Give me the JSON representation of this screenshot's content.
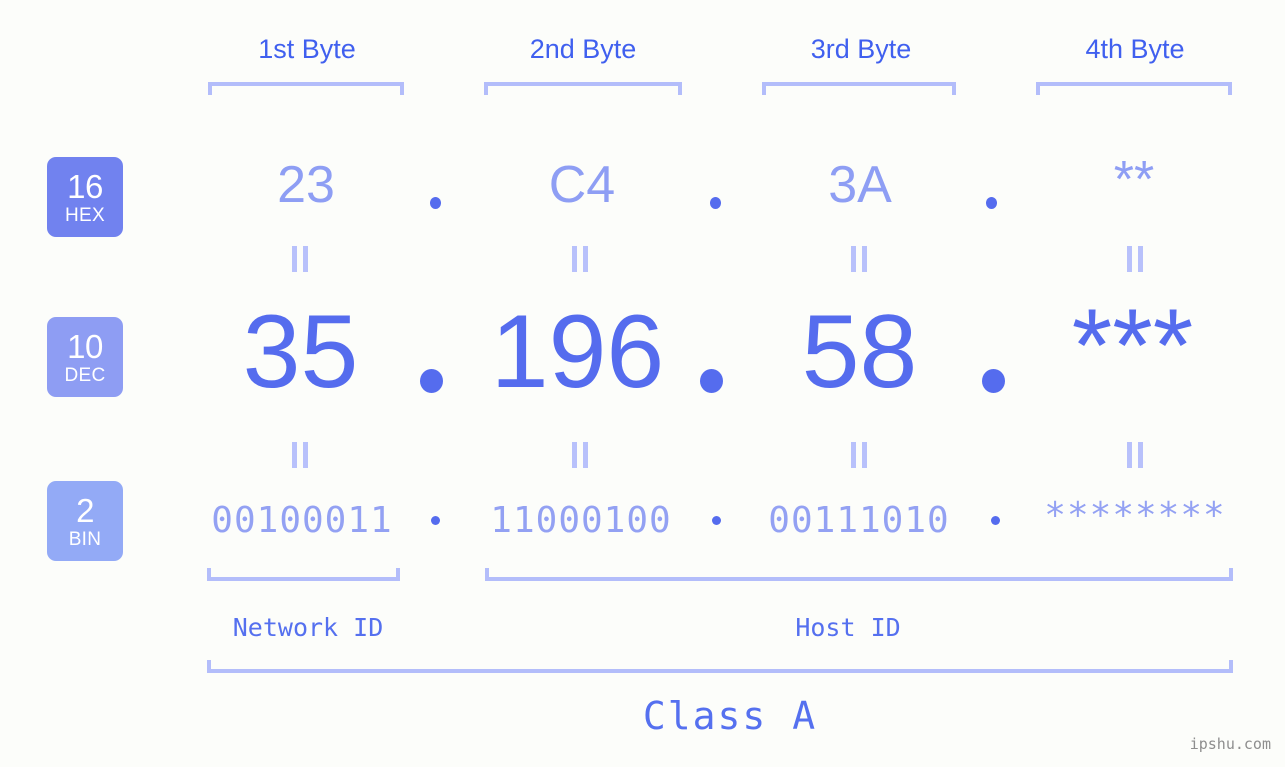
{
  "watermark": "ipshu.com",
  "colors": {
    "background": "#fcfdfa",
    "header_text": "#4060ef",
    "bracket": "#b3bdfa",
    "hex_value": "#8e9ef4",
    "dec_value": "#556cee",
    "bin_value": "#93a1f3",
    "dot": "#556cee",
    "equals": "#b8c1fb",
    "caption": "#5570ef",
    "badge_hex_bg": "#7182ef",
    "badge_dec_bg": "#8e9df3",
    "badge_bin_bg": "#93aaf6",
    "watermark": "#8e8e8e"
  },
  "byte_headers": [
    {
      "label": "1st Byte"
    },
    {
      "label": "2nd Byte"
    },
    {
      "label": "3rd Byte"
    },
    {
      "label": "4th Byte"
    }
  ],
  "radix_badges": [
    {
      "number": "16",
      "name": "HEX"
    },
    {
      "number": "10",
      "name": "DEC"
    },
    {
      "number": "2",
      "name": "BIN"
    }
  ],
  "rows": {
    "hex": {
      "values": [
        "23",
        "C4",
        "3A",
        "**"
      ]
    },
    "dec": {
      "values": [
        "35",
        "196",
        "58",
        "***"
      ]
    },
    "bin": {
      "values": [
        "00100011",
        "11000100",
        "00111010",
        "********"
      ]
    }
  },
  "separators": {
    "hex": [
      ".",
      ".",
      "."
    ],
    "dec": [
      ".",
      ".",
      "."
    ],
    "bin": [
      ".",
      ".",
      "."
    ]
  },
  "equals_marks": {
    "symbol": "=",
    "hex_to_dec_count": 4,
    "dec_to_bin_count": 4
  },
  "segments": {
    "network_id": "Network ID",
    "host_id": "Host ID",
    "ip_class": "Class A"
  },
  "chart_data": {
    "type": "table",
    "title": "IPv4 address 35.196.58.*** byte breakdown",
    "columns": [
      "1st Byte",
      "2nd Byte",
      "3rd Byte",
      "4th Byte"
    ],
    "rows": [
      {
        "radix": "16",
        "name": "HEX",
        "values": [
          "23",
          "C4",
          "3A",
          "**"
        ]
      },
      {
        "radix": "10",
        "name": "DEC",
        "values": [
          "35",
          "196",
          "58",
          "***"
        ]
      },
      {
        "radix": "2",
        "name": "BIN",
        "values": [
          "00100011",
          "11000100",
          "00111010",
          "********"
        ]
      }
    ],
    "annotations": {
      "network_id_span": [
        "1st Byte"
      ],
      "host_id_span": [
        "2nd Byte",
        "3rd Byte",
        "4th Byte"
      ],
      "class_span": [
        "1st Byte",
        "2nd Byte",
        "3rd Byte",
        "4th Byte"
      ],
      "class_label": "Class A"
    }
  }
}
